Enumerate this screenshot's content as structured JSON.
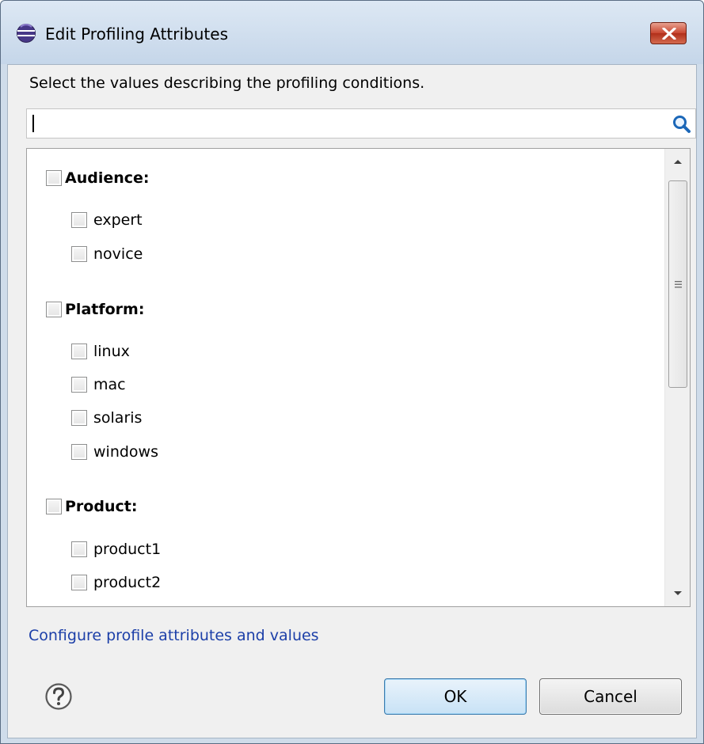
{
  "window": {
    "title": "Edit Profiling Attributes"
  },
  "dialog": {
    "description": "Select the values describing the profiling conditions.",
    "search": {
      "value": "",
      "placeholder": ""
    },
    "tree": {
      "groups": [
        {
          "label": "Audience:",
          "checked": false,
          "items": [
            {
              "label": "expert",
              "checked": false
            },
            {
              "label": "novice",
              "checked": false
            }
          ]
        },
        {
          "label": "Platform:",
          "checked": false,
          "items": [
            {
              "label": "linux",
              "checked": false
            },
            {
              "label": "mac",
              "checked": false
            },
            {
              "label": "solaris",
              "checked": false
            },
            {
              "label": "windows",
              "checked": false
            }
          ]
        },
        {
          "label": "Product:",
          "checked": false,
          "items": [
            {
              "label": "product1",
              "checked": false
            },
            {
              "label": "product2",
              "checked": false
            }
          ]
        }
      ]
    },
    "configure_link": "Configure profile attributes and values",
    "buttons": {
      "ok": "OK",
      "cancel": "Cancel"
    }
  },
  "colors": {
    "link": "#1c3fa8",
    "close_button": "#c8452f",
    "title_bar": "#c5d6e9"
  },
  "icons": {
    "app": "eclipse-icon",
    "search": "search-icon",
    "help": "help-icon",
    "close": "close-icon"
  }
}
